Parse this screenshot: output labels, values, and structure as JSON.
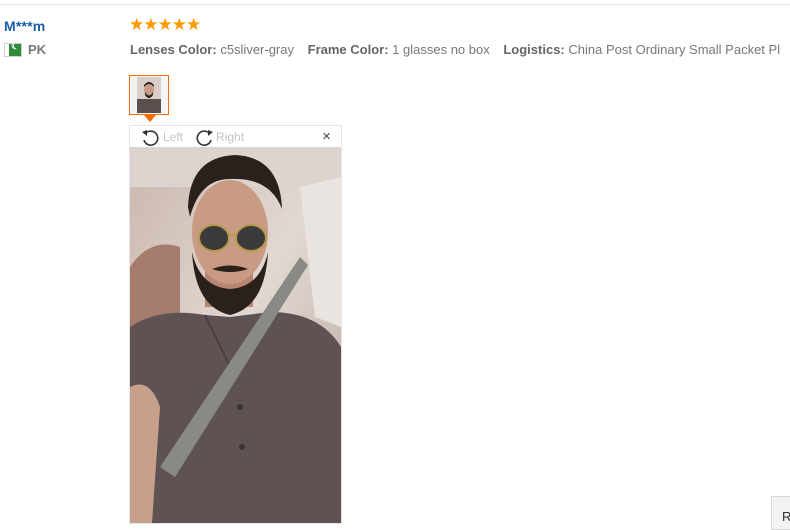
{
  "review": {
    "buyer": {
      "name": "M***m",
      "country_code": "PK",
      "flag_icon": "pakistan-flag-icon"
    },
    "rating": {
      "stars": 5,
      "star_glyphs": "★★★★★",
      "star_color": "#ff9900"
    },
    "attributes": [
      {
        "key": "Lenses Color:",
        "value": "c5sliver-gray"
      },
      {
        "key": "Frame Color:",
        "value": "1 glasses no box"
      },
      {
        "key": "Logistics:",
        "value": "China Post Ordinary Small Packet Pl"
      }
    ]
  },
  "viewer": {
    "rotate_left_label": "Left",
    "rotate_right_label": "Right",
    "close_glyph": "×",
    "rotate_left_icon": "rotate-left-icon",
    "rotate_right_icon": "rotate-right-icon",
    "close_icon": "close-icon"
  },
  "corner_button": {
    "label": "R"
  },
  "colors": {
    "accent": "#ef6c00",
    "buyer_name": "#1a5fa8",
    "text_muted": "#777777"
  }
}
